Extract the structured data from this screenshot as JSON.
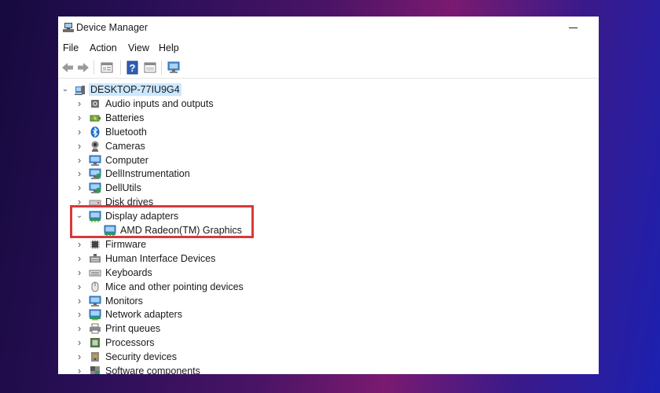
{
  "window": {
    "title": "Device Manager",
    "icon": "device-manager-icon"
  },
  "menu": [
    {
      "label": "File"
    },
    {
      "label": "Action"
    },
    {
      "label": "View"
    },
    {
      "label": "Help"
    }
  ],
  "toolbar": {
    "icons": [
      "back-arrow-icon",
      "forward-arrow-icon",
      "properties-view-icon",
      "help-icon",
      "panel-view-icon",
      "monitor-scan-icon"
    ]
  },
  "tree": {
    "root": {
      "label": "DESKTOP-77IU9G4",
      "icon": "computer-tower-icon",
      "expanded": true,
      "selected": true
    },
    "items": [
      {
        "label": "Audio inputs and outputs",
        "icon": "speaker-icon",
        "expanded": false
      },
      {
        "label": "Batteries",
        "icon": "battery-icon",
        "expanded": false
      },
      {
        "label": "Bluetooth",
        "icon": "bluetooth-icon",
        "expanded": false
      },
      {
        "label": "Cameras",
        "icon": "camera-icon",
        "expanded": false
      },
      {
        "label": "Computer",
        "icon": "computer-monitor-icon",
        "expanded": false
      },
      {
        "label": "DellInstrumentation",
        "icon": "dell-instrumentation-icon",
        "expanded": false
      },
      {
        "label": "DellUtils",
        "icon": "dell-utils-icon",
        "expanded": false
      },
      {
        "label": "Disk drives",
        "icon": "disk-drive-icon",
        "expanded": false
      },
      {
        "label": "Display adapters",
        "icon": "display-adapter-icon",
        "expanded": true
      },
      {
        "label": "AMD Radeon(TM) Graphics",
        "icon": "display-adapter-icon",
        "child": true
      },
      {
        "label": "Firmware",
        "icon": "firmware-chip-icon",
        "expanded": false
      },
      {
        "label": "Human Interface Devices",
        "icon": "hid-icon",
        "expanded": false
      },
      {
        "label": "Keyboards",
        "icon": "keyboard-icon",
        "expanded": false
      },
      {
        "label": "Mice and other pointing devices",
        "icon": "mouse-icon",
        "expanded": false
      },
      {
        "label": "Monitors",
        "icon": "monitor-icon",
        "expanded": false
      },
      {
        "label": "Network adapters",
        "icon": "network-adapter-icon",
        "expanded": false
      },
      {
        "label": "Print queues",
        "icon": "printer-icon",
        "expanded": false
      },
      {
        "label": "Processors",
        "icon": "processor-icon",
        "expanded": false
      },
      {
        "label": "Security devices",
        "icon": "security-device-icon",
        "expanded": false
      },
      {
        "label": "Software components",
        "icon": "software-component-icon",
        "expanded": false
      }
    ]
  },
  "annotation": {
    "color": "#d9383a"
  },
  "colors": {
    "selection": "#cce8ff",
    "accent": "#1e78c8"
  }
}
